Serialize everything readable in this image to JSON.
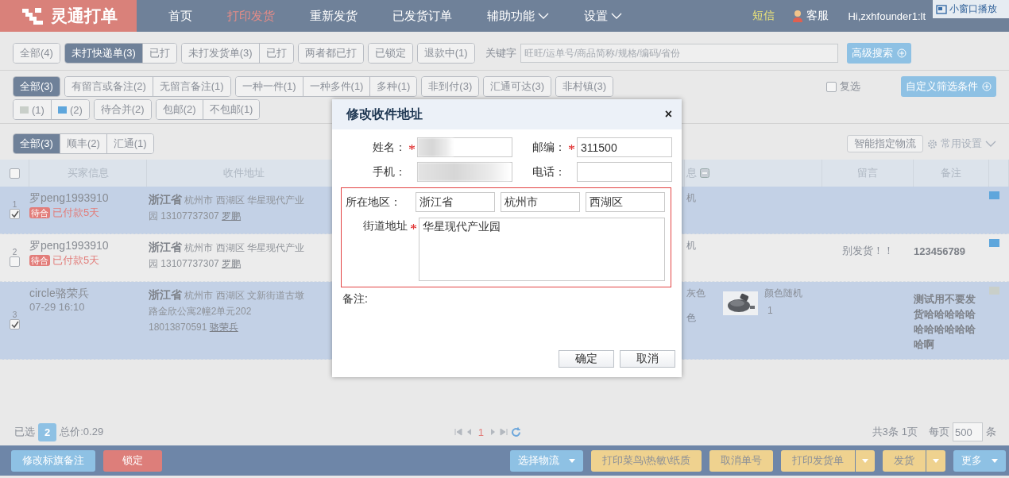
{
  "nav": {
    "logo": "灵通打单",
    "items": [
      {
        "label": "首页",
        "selected": false,
        "caret": false
      },
      {
        "label": "打印发货",
        "selected": true,
        "caret": false
      },
      {
        "label": "重新发货",
        "selected": false,
        "caret": false
      },
      {
        "label": "已发货订单",
        "selected": false,
        "caret": false
      },
      {
        "label": "辅助功能",
        "selected": false,
        "caret": true
      },
      {
        "label": "设置",
        "selected": false,
        "caret": true
      }
    ],
    "sms": "短信",
    "service": "客服",
    "user": "Hi,zxhfounder1:lt",
    "mini_window": "小窗口播放"
  },
  "filter_row_1": {
    "groups": [
      [
        {
          "label": "全部(4)",
          "selected": false
        }
      ],
      [
        {
          "label": "未打快递单(3)",
          "selected": true
        },
        {
          "label": "已打",
          "selected": false
        }
      ],
      [
        {
          "label": "未打发货单(3)",
          "selected": false
        },
        {
          "label": "已打",
          "selected": false
        }
      ],
      [
        {
          "label": "两者都已打",
          "selected": false
        }
      ],
      [
        {
          "label": "已锁定",
          "selected": false
        }
      ],
      [
        {
          "label": "退款中(1)",
          "selected": false
        }
      ]
    ],
    "keyword_label": "关键字",
    "keyword": {
      "placeholder": "旺旺/运单号/商品简称/规格/编码/省份"
    },
    "search_button": "高级搜索"
  },
  "filter_row_2": {
    "groups": [
      [
        {
          "label": "全部(3)",
          "selected": true
        }
      ],
      [
        {
          "label": "有留言或备注(2)",
          "selected": false
        },
        {
          "label": "无留言备注(1)",
          "selected": false
        }
      ],
      [
        {
          "label": "一种一件(1)",
          "selected": false
        },
        {
          "label": "一种多件(1)",
          "selected": false
        },
        {
          "label": "多种(1)",
          "selected": false
        }
      ],
      [
        {
          "label": "非到付(3)",
          "selected": false
        }
      ],
      [
        {
          "label": "汇通可达(3)",
          "selected": false
        }
      ],
      [
        {
          "label": "非村镇(3)",
          "selected": false
        }
      ]
    ],
    "multi_select": {
      "label": "复选",
      "checked": false
    },
    "custom_button": "自定义筛选条件"
  },
  "filter_row_3": {
    "groups": [
      [
        {
          "label": "(1)",
          "selected": false,
          "color": "#c9cfc9"
        },
        {
          "label": "(2)",
          "selected": false,
          "color": "#5ea6dc"
        }
      ],
      [
        {
          "label": "待合并(2)",
          "selected": false
        }
      ],
      [
        {
          "label": "包邮(2)",
          "selected": false
        },
        {
          "label": "不包邮(1)",
          "selected": false
        }
      ]
    ]
  },
  "carrier_tabs": [
    {
      "label": "全部(3)",
      "selected": true
    },
    {
      "label": "顺丰(2)",
      "selected": false
    },
    {
      "label": "汇通(1)",
      "selected": false
    }
  ],
  "smart_logistics_button": "智能指定物流",
  "common_settings": "常用设置",
  "table": {
    "columns": [
      "买家信息",
      "收件地址",
      "息",
      "留言",
      "备注"
    ],
    "all_checked": false,
    "rows": [
      {
        "index": "1",
        "checked": true,
        "buyer": "罗peng1993910",
        "tag": "待合",
        "status": "已付款5天",
        "province": "浙江省",
        "address": "杭州市 西湖区 华星现代产业园 13107737307",
        "receiver": "罗鹏",
        "product": [
          "机"
        ],
        "message": "",
        "remark": "",
        "color": "#5ea6dc"
      },
      {
        "index": "2",
        "checked": false,
        "buyer": "罗peng1993910",
        "tag": "待合",
        "status": "已付款5天",
        "province": "浙江省",
        "address": "杭州市 西湖区 华星现代产业园 13107737307",
        "receiver": "罗鹏",
        "product": [
          "机"
        ],
        "message": "别发货！！",
        "remark": "123456789",
        "color": "#5ea6dc"
      },
      {
        "index": "3",
        "checked": true,
        "buyer": "circle骆荣兵",
        "time": "07-29 16:10",
        "province": "浙江省",
        "address": "杭州市 西湖区 文新街道古墩路金欣公寓2幢2单元202 18013870591",
        "receiver": "骆荣兵",
        "product": [
          "灰色",
          "色"
        ],
        "thumbnail": {
          "kind": "picture"
        },
        "variant": "颜色随机",
        "quantity": "1",
        "message": "",
        "remark": "测试用不要发货哈哈哈哈哈哈哈哈哈哈哈哈啊",
        "color": "#c9cfc9"
      }
    ]
  },
  "footer": {
    "selected_label": "已选",
    "selected_count": "2",
    "total": "总价:0.29",
    "page": "1",
    "total_rows": "共3条",
    "pages": "1页",
    "per_page_label": "每页",
    "per_page": "500",
    "per_page_unit": "条"
  },
  "toolbar_left": [
    {
      "label": "修改标旗备注",
      "kind": "blue"
    },
    {
      "label": "锁定",
      "kind": "red"
    }
  ],
  "toolbar_right": [
    {
      "label": "选择物流",
      "kind": "bluemenu"
    },
    {
      "label": "打印菜鸟\\热敏\\纸质",
      "kind": "yellow"
    },
    {
      "label": "取消单号",
      "kind": "yellow"
    },
    {
      "label": "打印发货单",
      "kind": "yellowsplit"
    },
    {
      "label": "发货",
      "kind": "yellowsplit"
    },
    {
      "label": "更多",
      "kind": "bluemenu"
    }
  ],
  "dialog": {
    "title": "修改收件地址",
    "close": "×",
    "name": {
      "label": "姓名：",
      "required": true,
      "redacted": true
    },
    "zip": {
      "label": "邮编：",
      "required": true,
      "value": "311500"
    },
    "mobile": {
      "label": "手机：",
      "required": false,
      "redacted": true
    },
    "phone": {
      "label": "电话：",
      "required": false
    },
    "region": {
      "label": "所在地区：",
      "values": [
        "浙江省",
        "杭州市",
        "西湖区"
      ],
      "highlighted": true
    },
    "street": {
      "label": "街道地址",
      "required": true,
      "value": "华星现代产业园"
    },
    "remark_label": "备注:",
    "buttons": [
      "确定",
      "取消"
    ]
  }
}
